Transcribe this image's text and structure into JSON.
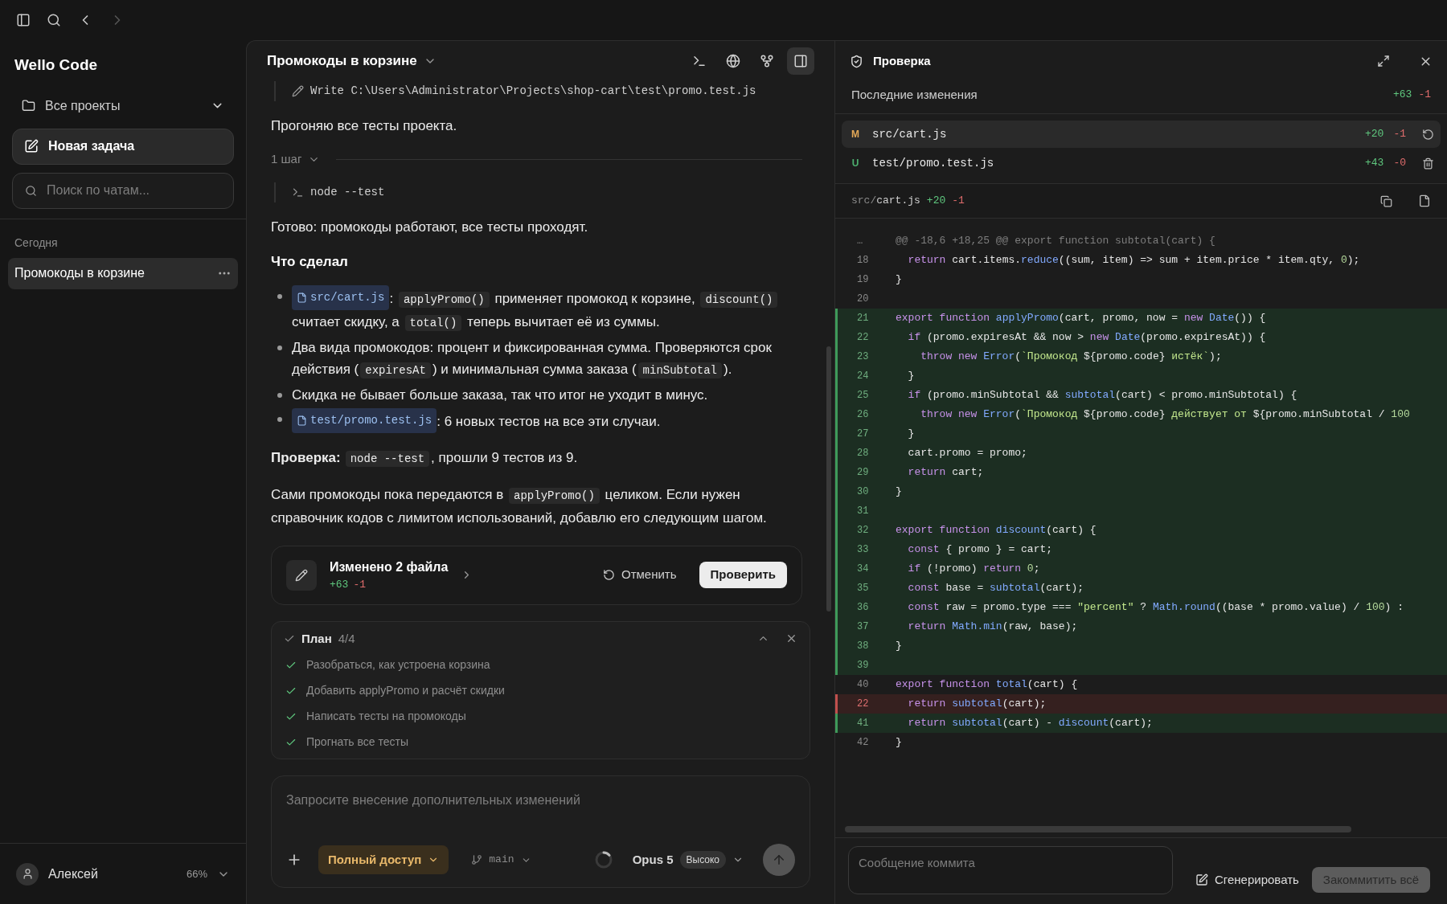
{
  "nav": {
    "back_disabled": false,
    "forward_disabled": true
  },
  "sidebar": {
    "app_title": "Wello Code",
    "project": "Все проекты",
    "new_task": "Новая задача",
    "search_placeholder": "Поиск по чатам...",
    "group": "Сегодня",
    "chats": [
      {
        "title": "Промокоды в корзине",
        "selected": true
      }
    ],
    "user": {
      "name": "Алексей",
      "usage": "66%"
    }
  },
  "chat": {
    "title": "Промокоды в корзине",
    "toolbar": [
      {
        "kind": "terminal",
        "selected": false
      },
      {
        "kind": "globe",
        "selected": false
      },
      {
        "kind": "branch",
        "selected": false
      },
      {
        "kind": "panel",
        "selected": true
      }
    ],
    "blocks": [
      {
        "kind": "write",
        "text": "Write C:\\Users\\Administrator\\Projects\\shop-cart\\test\\promo.test.js"
      },
      {
        "kind": "paragraph",
        "segments": [
          {
            "kind": "text",
            "text": "Прогоняю все тесты проекта."
          }
        ]
      },
      {
        "kind": "steps",
        "label": "1 шаг",
        "expanded": true
      },
      {
        "kind": "command",
        "text": "node --test"
      },
      {
        "kind": "paragraph",
        "segments": [
          {
            "kind": "text",
            "text": "Готово: промокоды работают, все тесты проходят."
          }
        ]
      },
      {
        "kind": "heading",
        "text": "Что сделал"
      },
      {
        "kind": "bullets",
        "items": [
          [
            {
              "kind": "file",
              "text": "src/cart.js"
            },
            {
              "kind": "text",
              "text": ": "
            },
            {
              "kind": "code",
              "text": "applyPromo()"
            },
            {
              "kind": "text",
              "text": " применяет промокод к корзине, "
            },
            {
              "kind": "code",
              "text": "discount()"
            },
            {
              "kind": "text",
              "text": " считает скидку, а "
            },
            {
              "kind": "code",
              "text": "total()"
            },
            {
              "kind": "text",
              "text": " теперь вычитает её из суммы."
            }
          ],
          [
            {
              "kind": "text",
              "text": "Два вида промокодов: процент и фиксированная сумма. Проверяются срок действия ("
            },
            {
              "kind": "code",
              "text": "expiresAt"
            },
            {
              "kind": "text",
              "text": ") и минимальная сумма заказа ("
            },
            {
              "kind": "code",
              "text": "minSubtotal"
            },
            {
              "kind": "text",
              "text": ")."
            }
          ],
          [
            {
              "kind": "text",
              "text": "Скидка не бывает больше заказа, так что итог не уходит в минус."
            }
          ],
          [
            {
              "kind": "file",
              "text": "test/promo.test.js"
            },
            {
              "kind": "text",
              "text": ": 6 новых тестов на все эти случаи."
            }
          ]
        ]
      },
      {
        "kind": "paragraph",
        "segments": [
          {
            "kind": "bold",
            "text": "Проверка:"
          },
          {
            "kind": "code",
            "text": "node --test"
          },
          {
            "kind": "text",
            "text": ", прошли 9 тестов из 9."
          }
        ]
      },
      {
        "kind": "paragraph",
        "segments": [
          {
            "kind": "text",
            "text": "Сами промокоды пока передаются в "
          },
          {
            "kind": "code",
            "text": "applyPromo()"
          },
          {
            "kind": "text",
            "text": " целиком. Если нужен справочник кодов с лимитом использований, добавлю его следующим шагом."
          }
        ]
      }
    ],
    "changes": {
      "title": "Изменено 2 файла",
      "added": "+63",
      "removed": "-1",
      "undo": "Отменить",
      "review": "Проверить"
    },
    "plan": {
      "title": "План",
      "count": "4/4",
      "expanded": true,
      "items": [
        {
          "text": "Разобраться, как устроена корзина",
          "done": true
        },
        {
          "text": "Добавить applyPromo и расчёт скидки",
          "done": true
        },
        {
          "text": "Написать тесты на промокоды",
          "done": true
        },
        {
          "text": "Прогнать все тесты",
          "done": true
        }
      ]
    },
    "composer": {
      "placeholder": "Запросите внесение дополнительных изменений",
      "access": "Полный доступ",
      "branch": "main",
      "busy": true,
      "model": "Opus 5",
      "effort": "Высоко"
    }
  },
  "review": {
    "title": "Проверка",
    "summary": {
      "label": "Последние изменения",
      "added": "+63",
      "removed": "-1"
    },
    "files": [
      {
        "status": "M",
        "color": "#e3a857",
        "path": "src/cart.js",
        "added": "+20",
        "removed": "-1",
        "selected": true,
        "kind": "revert"
      },
      {
        "status": "U",
        "color": "#4caf6e",
        "path": "test/promo.test.js",
        "added": "+43",
        "removed": "-0",
        "selected": false,
        "kind": "delete"
      }
    ],
    "diff": {
      "dir": "src/",
      "file": "cart.js",
      "added": "+20",
      "removed": "-1",
      "lines": [
        {
          "num": "…",
          "kind": "hunk",
          "tokens": [
            {
              "kind": "dim",
              "text": "@@ -18,6 +18,25 @@ export function subtotal(cart) {"
            }
          ]
        },
        {
          "num": "18",
          "kind": "context",
          "tokens": [
            {
              "kind": "kw",
              "text": "  return"
            },
            {
              "kind": "p",
              "text": " cart.items."
            },
            {
              "kind": "fn",
              "text": "reduce"
            },
            {
              "kind": "p",
              "text": "((sum, item) => sum + item.price * item.qty, "
            },
            {
              "kind": "num",
              "text": "0"
            },
            {
              "kind": "p",
              "text": ");"
            }
          ]
        },
        {
          "num": "19",
          "kind": "context",
          "tokens": [
            {
              "kind": "p",
              "text": "}"
            }
          ]
        },
        {
          "num": "20",
          "kind": "context"
        },
        {
          "num": "21",
          "kind": "added",
          "tokens": [
            {
              "kind": "kw",
              "text": "export function "
            },
            {
              "kind": "fn",
              "text": "applyPromo"
            },
            {
              "kind": "p",
              "text": "(cart, promo, now = "
            },
            {
              "kind": "kw",
              "text": "new "
            },
            {
              "kind": "fn",
              "text": "Date"
            },
            {
              "kind": "p",
              "text": "()) {"
            }
          ]
        },
        {
          "num": "22",
          "kind": "added",
          "tokens": [
            {
              "kind": "kw",
              "text": "  if"
            },
            {
              "kind": "p",
              "text": " (promo.expiresAt && now > "
            },
            {
              "kind": "kw",
              "text": "new "
            },
            {
              "kind": "fn",
              "text": "Date"
            },
            {
              "kind": "p",
              "text": "(promo.expiresAt)) {"
            }
          ]
        },
        {
          "num": "23",
          "kind": "added",
          "tokens": [
            {
              "kind": "kw",
              "text": "    throw new "
            },
            {
              "kind": "fn",
              "text": "Error"
            },
            {
              "kind": "p",
              "text": "("
            },
            {
              "kind": "str",
              "text": "`Промокод "
            },
            {
              "kind": "p",
              "text": "${promo.code}"
            },
            {
              "kind": "str",
              "text": " истёк`"
            },
            {
              "kind": "p",
              "text": ");"
            }
          ]
        },
        {
          "num": "24",
          "kind": "added",
          "tokens": [
            {
              "kind": "p",
              "text": "  }"
            }
          ]
        },
        {
          "num": "25",
          "kind": "added",
          "tokens": [
            {
              "kind": "kw",
              "text": "  if"
            },
            {
              "kind": "p",
              "text": " (promo.minSubtotal && "
            },
            {
              "kind": "fn",
              "text": "subtotal"
            },
            {
              "kind": "p",
              "text": "(cart) < promo.minSubtotal) {"
            }
          ]
        },
        {
          "num": "26",
          "kind": "added",
          "tokens": [
            {
              "kind": "kw",
              "text": "    throw new "
            },
            {
              "kind": "fn",
              "text": "Error"
            },
            {
              "kind": "p",
              "text": "("
            },
            {
              "kind": "str",
              "text": "`Промокод "
            },
            {
              "kind": "p",
              "text": "${promo.code}"
            },
            {
              "kind": "str",
              "text": " действует от "
            },
            {
              "kind": "p",
              "text": "${promo.minSubtotal / "
            },
            {
              "kind": "num",
              "text": "100"
            }
          ]
        },
        {
          "num": "27",
          "kind": "added",
          "tokens": [
            {
              "kind": "p",
              "text": "  }"
            }
          ]
        },
        {
          "num": "28",
          "kind": "added",
          "tokens": [
            {
              "kind": "p",
              "text": "  cart.promo = promo;"
            }
          ]
        },
        {
          "num": "29",
          "kind": "added",
          "tokens": [
            {
              "kind": "kw",
              "text": "  return"
            },
            {
              "kind": "p",
              "text": " cart;"
            }
          ]
        },
        {
          "num": "30",
          "kind": "added",
          "tokens": [
            {
              "kind": "p",
              "text": "}"
            }
          ]
        },
        {
          "num": "31",
          "kind": "added"
        },
        {
          "num": "32",
          "kind": "added",
          "tokens": [
            {
              "kind": "kw",
              "text": "export function "
            },
            {
              "kind": "fn",
              "text": "discount"
            },
            {
              "kind": "p",
              "text": "(cart) {"
            }
          ]
        },
        {
          "num": "33",
          "kind": "added",
          "tokens": [
            {
              "kind": "kw",
              "text": "  const"
            },
            {
              "kind": "p",
              "text": " { promo } = cart;"
            }
          ]
        },
        {
          "num": "34",
          "kind": "added",
          "tokens": [
            {
              "kind": "kw",
              "text": "  if"
            },
            {
              "kind": "p",
              "text": " (!promo) "
            },
            {
              "kind": "kw",
              "text": "return "
            },
            {
              "kind": "num",
              "text": "0"
            },
            {
              "kind": "p",
              "text": ";"
            }
          ]
        },
        {
          "num": "35",
          "kind": "added",
          "tokens": [
            {
              "kind": "kw",
              "text": "  const"
            },
            {
              "kind": "p",
              "text": " base = "
            },
            {
              "kind": "fn",
              "text": "subtotal"
            },
            {
              "kind": "p",
              "text": "(cart);"
            }
          ]
        },
        {
          "num": "36",
          "kind": "added",
          "tokens": [
            {
              "kind": "kw",
              "text": "  const"
            },
            {
              "kind": "p",
              "text": " raw = promo.type === "
            },
            {
              "kind": "str",
              "text": "\"percent\""
            },
            {
              "kind": "p",
              "text": " ? "
            },
            {
              "kind": "fn",
              "text": "Math.round"
            },
            {
              "kind": "p",
              "text": "((base * promo.value) / "
            },
            {
              "kind": "num",
              "text": "100"
            },
            {
              "kind": "p",
              "text": ") :"
            }
          ]
        },
        {
          "num": "37",
          "kind": "added",
          "tokens": [
            {
              "kind": "kw",
              "text": "  return "
            },
            {
              "kind": "fn",
              "text": "Math.min"
            },
            {
              "kind": "p",
              "text": "(raw, base);"
            }
          ]
        },
        {
          "num": "38",
          "kind": "added",
          "tokens": [
            {
              "kind": "p",
              "text": "}"
            }
          ]
        },
        {
          "num": "39",
          "kind": "added"
        },
        {
          "num": "40",
          "kind": "context",
          "tokens": [
            {
              "kind": "kw",
              "text": "export function "
            },
            {
              "kind": "fn",
              "text": "total"
            },
            {
              "kind": "p",
              "text": "(cart) {"
            }
          ]
        },
        {
          "num": "22",
          "kind": "removed",
          "tokens": [
            {
              "kind": "kw",
              "text": "  return "
            },
            {
              "kind": "fn",
              "text": "subtotal"
            },
            {
              "kind": "p",
              "text": "(cart);"
            }
          ]
        },
        {
          "num": "41",
          "kind": "added",
          "tokens": [
            {
              "kind": "kw",
              "text": "  return "
            },
            {
              "kind": "fn",
              "text": "subtotal"
            },
            {
              "kind": "p",
              "text": "(cart) - "
            },
            {
              "kind": "fn",
              "text": "discount"
            },
            {
              "kind": "p",
              "text": "(cart);"
            }
          ]
        },
        {
          "num": "42",
          "kind": "context",
          "tokens": [
            {
              "kind": "p",
              "text": "}"
            }
          ]
        }
      ]
    },
    "commit": {
      "placeholder": "Сообщение коммита",
      "generate": "Сгенерировать",
      "commit": "Закоммитить всё",
      "commit_disabled": true
    }
  }
}
